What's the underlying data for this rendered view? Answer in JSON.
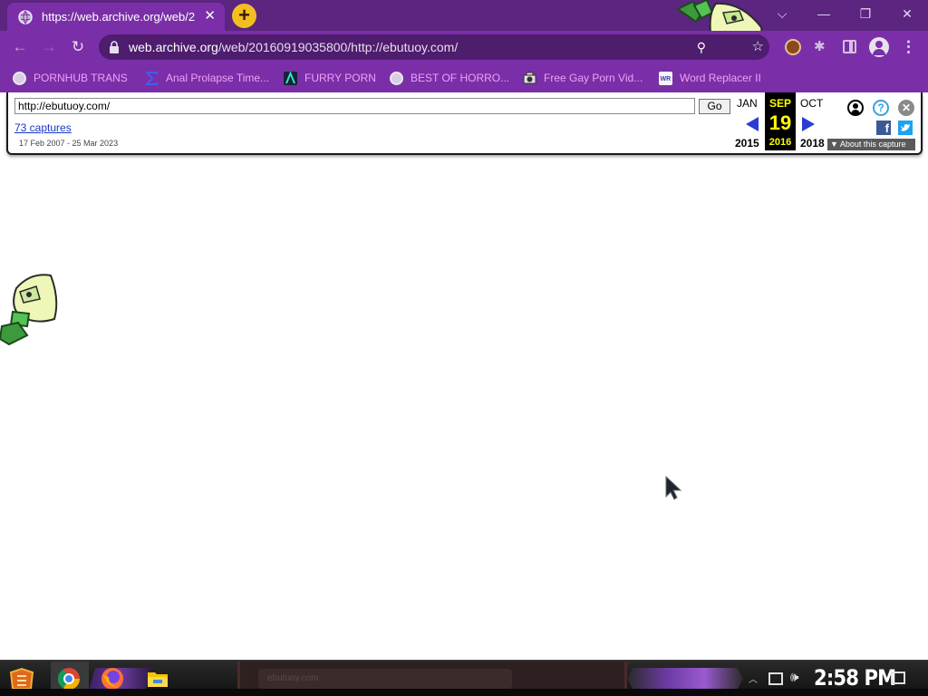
{
  "browser": {
    "tab_title": "https://web.archive.org/web/2",
    "tab_close": "✕",
    "new_tab": "+",
    "window_controls": {
      "tab_search": "⌵",
      "minimize": "—",
      "maximize": "❐",
      "close": "✕"
    },
    "address": {
      "domain": "web.archive.org",
      "path": "/web/20160919035800/http://ebutuoy.com/"
    }
  },
  "bookmarks": [
    {
      "label": "PORNHUB TRANS",
      "icon": "globe-icon"
    },
    {
      "label": "Anal Prolapse Time...",
      "icon": "sigma-icon"
    },
    {
      "label": "FURRY PORN",
      "icon": "lambda-icon"
    },
    {
      "label": "BEST OF HORRO...",
      "icon": "globe-icon"
    },
    {
      "label": "Free Gay Porn Vid...",
      "icon": "camera-icon"
    },
    {
      "label": "Word Replacer II",
      "icon": "wr-icon"
    }
  ],
  "wayback": {
    "url_value": "http://ebutuoy.com/",
    "go_label": "Go",
    "captures_label": "73 captures",
    "date_range": "17 Feb 2007 - 25 Mar 2023",
    "prev_month": "JAN",
    "current_month": "SEP",
    "next_month": "OCT",
    "current_day": "19",
    "prev_year": "2015",
    "current_year": "2016",
    "next_year": "2018",
    "about_label": "▼ About this capture",
    "help_glyph": "?",
    "close_glyph": "✕",
    "facebook_glyph": "f"
  },
  "taskbar": {
    "center_caption": "ebutuoy.com",
    "clock": "2:58 PM",
    "tray_up": "︿"
  },
  "colors": {
    "chrome_dark": "#5b2580",
    "chrome": "#7a2fa8",
    "bookmark_text": "#f0a0f6",
    "wayback_highlight": "#ffff00",
    "wayback_arrow": "#2b3bd4"
  }
}
